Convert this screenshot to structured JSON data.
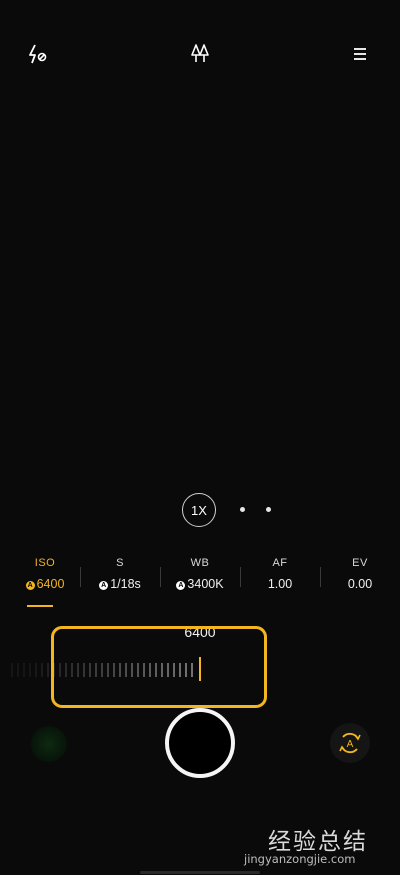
{
  "top_bar": {
    "flash_icon": "flash-off-icon",
    "tree_icon": "scene-tree-icon",
    "menu_icon": "menu-icon"
  },
  "zoom": {
    "label": "1X",
    "dot_count": 2
  },
  "params": [
    {
      "label": "ISO",
      "value": "6400",
      "auto": true,
      "active": true
    },
    {
      "label": "S",
      "value": "1/18s",
      "auto": true,
      "active": false
    },
    {
      "label": "WB",
      "value": "3400K",
      "auto": true,
      "active": false
    },
    {
      "label": "AF",
      "value": "1.00",
      "auto": false,
      "active": false
    },
    {
      "label": "EV",
      "value": "0.00",
      "auto": false,
      "active": false
    }
  ],
  "slider": {
    "current_value": "6400"
  },
  "switch_button": {
    "label": "A",
    "icon": "rotate-camera-icon"
  },
  "watermark": {
    "title": "经验总结",
    "url": "jingyanzongjie.com"
  },
  "colors": {
    "accent": "#f3b61f",
    "background": "#0a0a0a"
  }
}
